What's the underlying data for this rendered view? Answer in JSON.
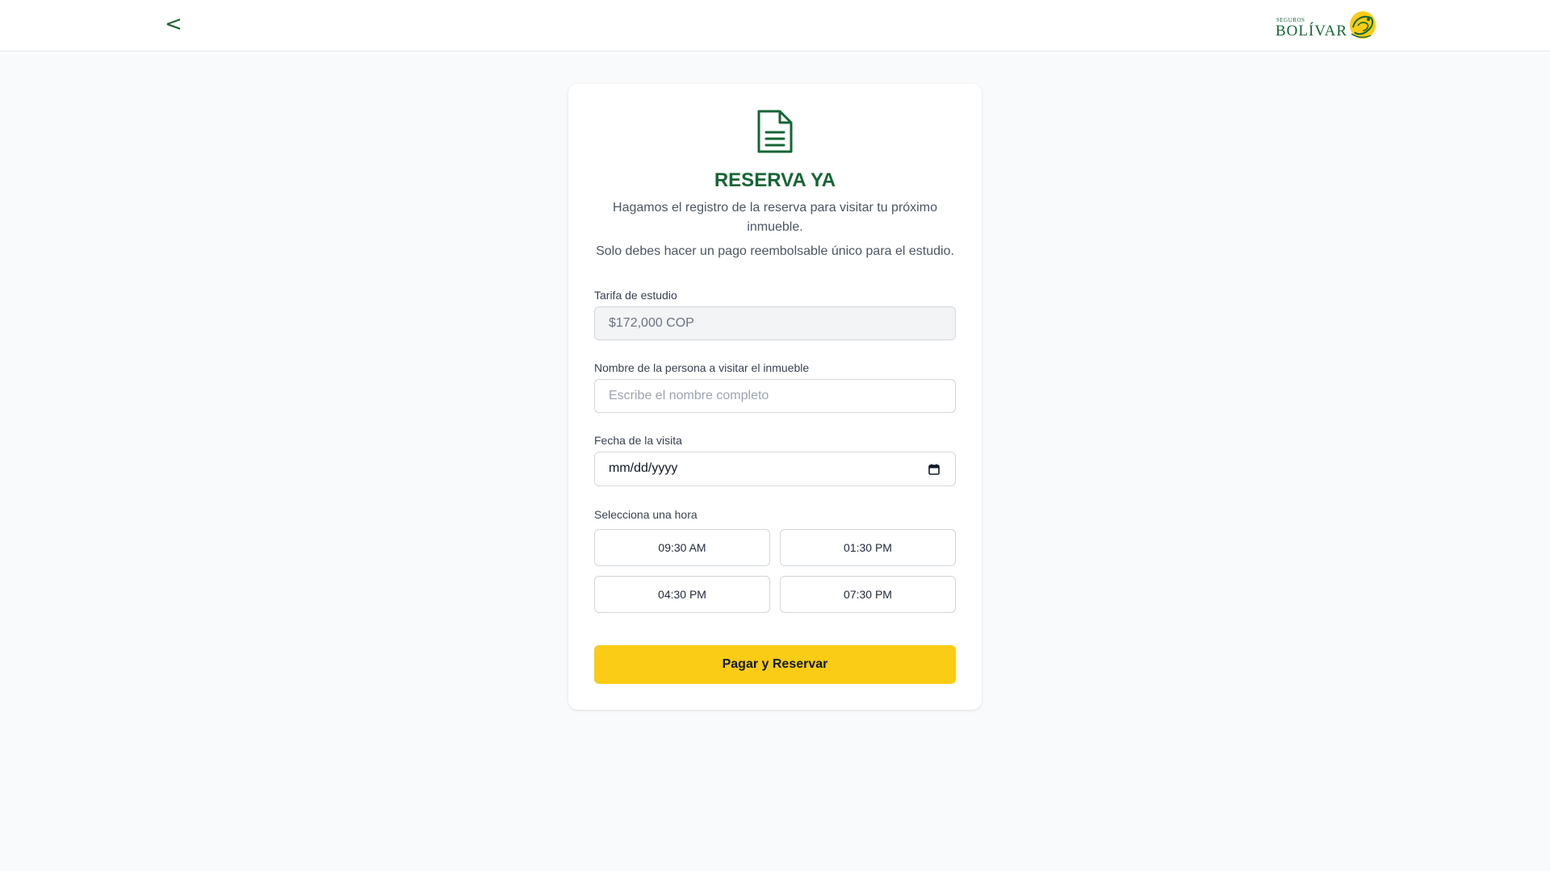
{
  "header": {
    "back_label": "<",
    "logo_small": "SEGUROS",
    "logo_big": "BOLÍVAR"
  },
  "card": {
    "icon": "document-icon",
    "title": "RESERVA YA",
    "subtitle": "Hagamos el registro de la reserva para visitar tu próximo inmueble.",
    "subtitle2": "Solo debes hacer un pago reembolsable único para el estudio."
  },
  "form": {
    "fee_label": "Tarifa de estudio",
    "fee_value": "$172,000 COP",
    "name_label": "Nombre de la persona a visitar el inmueble",
    "name_placeholder": "Escribe el nombre completo",
    "date_label": "Fecha de la visita",
    "date_value": "mm/dd/yyyy",
    "time_label": "Selecciona una hora",
    "times": [
      "09:30 AM",
      "01:30 PM",
      "04:30 PM",
      "07:30 PM"
    ],
    "submit_label": "Pagar y Reservar"
  },
  "colors": {
    "brand_green": "#166534",
    "accent_yellow": "#facc15"
  }
}
